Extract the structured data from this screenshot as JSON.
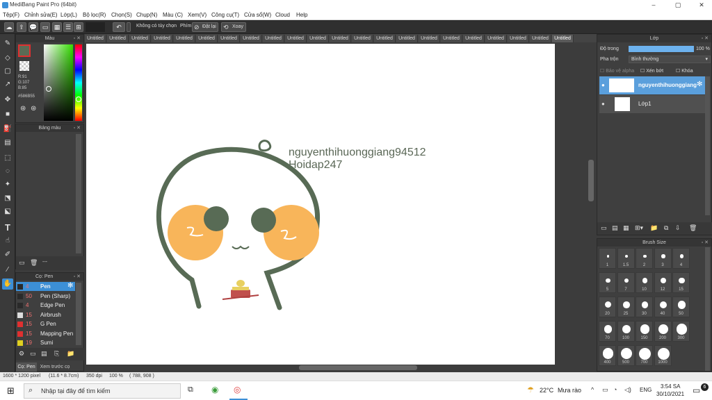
{
  "window": {
    "title": "MediBang Paint Pro (64bit)",
    "minimize": "–",
    "maximize": "▢",
    "close": "✕"
  },
  "menu": [
    "Tệp(F)",
    "Chỉnh sửa(E)",
    "Lớp(L)",
    "Bộ lọc(R)",
    "Chọn(S)",
    "Chụp(N)",
    "Màu (C)",
    "Xem(V)",
    "Công cụ(T)",
    "Cửa sổ(W)",
    "Cloud",
    "Help"
  ],
  "toolbar": {
    "option_label": "Không có tùy chọn",
    "keys_label": "Phím",
    "reset_label": "Đặt lại",
    "rotate_label": "Xoay"
  },
  "tabs": [
    "Untitled",
    "Untitled",
    "Untitled",
    "Untitled",
    "Untitled",
    "Untitled",
    "Untitled",
    "Untitled",
    "Untitled",
    "Untitled",
    "Untitled",
    "Untitled",
    "Untitled",
    "Untitled",
    "Untitled",
    "Untitled",
    "Untitled",
    "Untitled",
    "Untitled",
    "Untitled",
    "Untitled",
    "Untitled"
  ],
  "color_panel": {
    "title": "Màu",
    "r": "R:91",
    "g": "G:107",
    "b": "B:85",
    "hex": "#586B55",
    "current_color": "#5b6b55"
  },
  "palette_panel": {
    "title": "Bảng màu",
    "colors": [
      "#000000",
      "#333333",
      "#8b5a5a",
      "#e0b0b0",
      "#ffffff",
      "#f2d0c8",
      "#c8c8c8",
      "#e8c8c0",
      "#f0a0a0",
      "#e03050"
    ],
    "more": "---"
  },
  "brush_panel": {
    "title": "Cọ: Pen",
    "items": [
      {
        "size": "4",
        "name": "Pen",
        "color": "#2a2a2a"
      },
      {
        "size": "50",
        "name": "Pen (Sharp)",
        "color": "#2a2a2a"
      },
      {
        "size": "4",
        "name": "Edge Pen",
        "color": "#2a2a2a"
      },
      {
        "size": "15",
        "name": "Airbrush",
        "color": "#dddddd"
      },
      {
        "size": "15",
        "name": "G Pen",
        "color": "#e03030"
      },
      {
        "size": "15",
        "name": "Mapping Pen",
        "color": "#e03030"
      },
      {
        "size": "19",
        "name": "Sumi",
        "color": "#e0d020"
      }
    ],
    "tab1": "Cọ: Pen",
    "tab2": "Xem trước cọ"
  },
  "layer_panel": {
    "title": "Lớp",
    "opacity_label": "Độ trong",
    "opacity_value": "100 %",
    "opacity": 1.0,
    "blend_label": "Pha trộn",
    "blend_value": "Bình thường",
    "protect_alpha": "Bảo vệ alpha",
    "clipping": "Xén bớt",
    "lock": "Khóa",
    "layers": [
      {
        "name": "nguyenthihuonggiang",
        "active": true
      },
      {
        "name": "Lớp1",
        "active": false
      }
    ]
  },
  "brush_size_panel": {
    "title": "Brush Size",
    "sizes": [
      "1",
      "1.5",
      "2",
      "3",
      "4",
      "5",
      "7",
      "10",
      "12",
      "15",
      "20",
      "25",
      "30",
      "40",
      "50",
      "70",
      "100",
      "150",
      "200",
      "300",
      "400",
      "500",
      "700",
      "1000"
    ]
  },
  "canvas": {
    "watermark_line1": "nguyenthihuonggiang94512",
    "watermark_line2": "Hoidap247"
  },
  "status": {
    "size": "1600 * 1200 pixel",
    "cm": "(11.6 * 8.7cm)",
    "dpi": "350 dpi",
    "zoom": "100 %",
    "coords": "( 788, 908 )"
  },
  "taskbar": {
    "search_placeholder": "Nhập tại đây để tìm kiếm",
    "weather_temp": "22°C",
    "weather_text": "Mưa rào",
    "lang": "ENG",
    "time": "3:54 SA",
    "date": "30/10/2021",
    "notifications": "6"
  }
}
